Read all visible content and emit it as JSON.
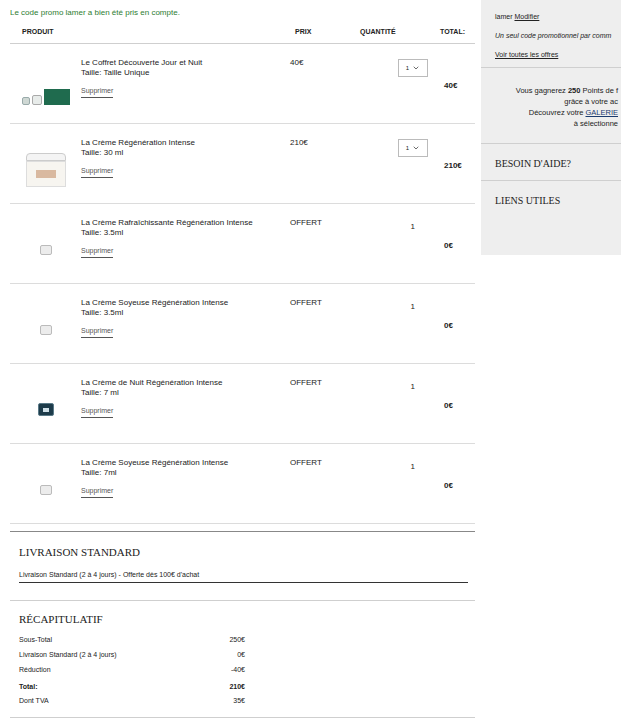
{
  "notice": "Le code promo lamer a bien été pris en compte.",
  "columns": [
    "PRODUIT",
    "PRIX",
    "QUANTITÉ",
    "TOTAL:"
  ],
  "items": [
    {
      "name": "Le Coffret Découverte Jour et Nuit",
      "size": "Taille: Taille Unique",
      "price": "40€",
      "quantity": "1",
      "total": "40€",
      "kind": "select",
      "thumb": "set",
      "remove": "Supprimer"
    },
    {
      "name": "La Crème Régénération Intense",
      "size": "Taille: 30 ml",
      "price": "210€",
      "quantity": "1",
      "total": "210€",
      "kind": "select",
      "thumb": "jar",
      "remove": "Supprimer"
    },
    {
      "name": "La Crème Rafraîchissante Régénération Intense",
      "size": "Taille: 3.5ml",
      "price": "OFFERT",
      "quantity": "1",
      "total": "0€",
      "kind": "fixed",
      "thumb": "mini",
      "remove": "Supprimer"
    },
    {
      "name": "La Crème Soyeuse Régénération Intense",
      "size": "Taille: 3.5ml",
      "price": "OFFERT",
      "quantity": "1",
      "total": "0€",
      "kind": "fixed",
      "thumb": "mini",
      "remove": "Supprimer"
    },
    {
      "name": "La Crème de Nuit Régénération Intense",
      "size": "Taille: 7 ml",
      "price": "OFFERT",
      "quantity": "1",
      "total": "0€",
      "kind": "fixed",
      "thumb": "night",
      "remove": "Supprimer"
    },
    {
      "name": "La Crème Soyeuse Régénération Intense",
      "size": "Taille: 7ml",
      "price": "OFFERT",
      "quantity": "1",
      "total": "0€",
      "kind": "fixed",
      "thumb": "mini",
      "remove": "Supprimer"
    }
  ],
  "shipping": {
    "title": "LIVRAISON STANDARD",
    "option": "Livraison Standard (2 à 4 jours) - Offerte dès 100€ d'achat"
  },
  "summary": {
    "title": "RÉCAPITULATIF",
    "rows": [
      {
        "label": "Sous-Total",
        "value": "250€",
        "bold": false
      },
      {
        "label": "Livraison Standard (2 à 4 jours)",
        "value": "0€",
        "bold": false
      },
      {
        "label": "Réduction",
        "value": "-40€",
        "bold": false
      },
      {
        "label": "Total:",
        "value": "210€",
        "bold": true
      },
      {
        "label": "Dont TVA",
        "value": "35€",
        "bold": false
      }
    ]
  },
  "sidebar": {
    "promo_code": "lamer",
    "modify": "Modifier",
    "promo_note": "Un seul code promotionnel par comm",
    "offers_link": "Voir toutes les offres",
    "points_lines": [
      [
        {
          "text": "Vous gagnerez ",
          "bold": false,
          "underline": false
        },
        {
          "text": "250",
          "bold": true,
          "underline": false
        },
        {
          "text": " Points de f",
          "bold": false,
          "underline": false
        }
      ],
      [
        {
          "text": "grâce à votre ac",
          "bold": false,
          "underline": false
        }
      ],
      [
        {
          "text": "Découvrez votre ",
          "bold": false,
          "underline": false
        },
        {
          "text": "GALERIE",
          "bold": false,
          "underline": true
        }
      ],
      [
        {
          "text": "à sélectionne",
          "bold": false,
          "underline": false
        }
      ]
    ],
    "sections": [
      "BESOIN D'AIDE?",
      "LIENS UTILES"
    ]
  }
}
